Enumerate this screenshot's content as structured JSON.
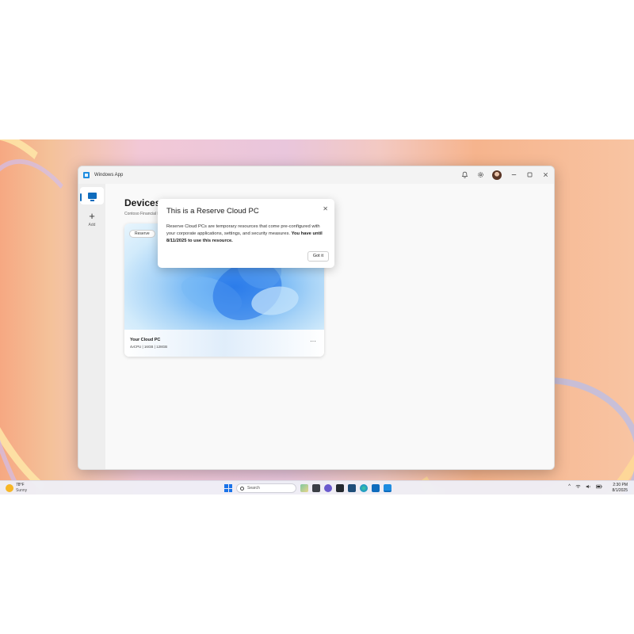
{
  "window": {
    "app_title": "Windows App"
  },
  "sidebar": {
    "items": [
      {
        "label": "",
        "icon": "monitor-icon",
        "selected": true
      },
      {
        "label": "Add",
        "icon": "plus-icon",
        "selected": false
      }
    ]
  },
  "main": {
    "page_title": "Devices",
    "org_name": "Contoso Financial Ex"
  },
  "device_card": {
    "badge": "Reserve",
    "name": "Your Cloud PC",
    "specs": "4vCPU | 16GB | 128GB",
    "more_label": "···"
  },
  "popup": {
    "title": "This is a Reserve Cloud PC",
    "body_text": "Reserve Cloud PCs are temporary resources that come pre-configured with your corporate applications, settings, and security measures. ",
    "body_bold": "You have until 8/11/2025 to use this resource.",
    "button_label": "Got it",
    "close_glyph": "✕"
  },
  "taskbar": {
    "weather_temp": "78°F",
    "weather_condition": "Sunny",
    "search_placeholder": "Search",
    "time": "2:30 PM",
    "date": "8/1/2025"
  },
  "colors": {
    "accent": "#0f6cbd",
    "taskbar_blue": "#1a73e8"
  }
}
